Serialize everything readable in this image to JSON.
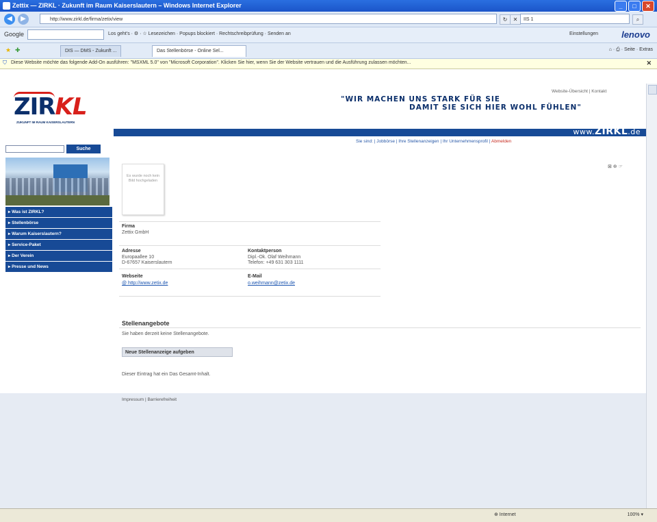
{
  "window": {
    "title": "Zettix — ZIRKL · Zukunft im Raum Kaiserslautern – Windows Internet Explorer",
    "minimize": "_",
    "maximize": "□",
    "close": "✕"
  },
  "addressbar": {
    "url": "http://www.zirkl.de/firma/zetix/view",
    "search_placeholder": "IIS 1",
    "back": "◀",
    "forward": "▶",
    "go": "↻",
    "stop": "✕",
    "search_go": "⌕"
  },
  "googlebar": {
    "label": "Google",
    "items": "Los geht's · ⚙ · ☆ Lesezeichen · Popups blockiert · Rechtschreibprüfung · Senden an",
    "settings": "Einstellungen",
    "brand": "lenovo"
  },
  "tabs": {
    "items": [
      "DIS — DMS - Zukunft ...",
      "Das Stellenbörse - Online Sel..."
    ],
    "tools": "⌂ · ⎙ · Seite · Extras"
  },
  "infobar": {
    "message": "Diese Website möchte das folgende Add-On ausführen: \"MSXML 5.0\" von \"Microsoft Corporation\". Klicken Sie hier, wenn Sie der Website vertrauen und die Ausführung zulassen möchten...",
    "close": "✕"
  },
  "site": {
    "logo_main": "ZIR",
    "logo_accent": "KL",
    "logo_sub": "ZUKUNFT IM RAUM KAISERSLAUTERN",
    "top_links": "Website-Übersicht | Kontakt",
    "slogan_line1": "\"WIR MACHEN UNS STARK FÜR SIE",
    "slogan_line2": "DAMIT SIE SICH HIER WOHL FÜHLEN\"",
    "domain_pre": "www.",
    "domain_brand": "ZIRKL",
    "domain_tld": ".de",
    "subnav": "Sie sind: | Jobbörse | Ihre Stellenanzeigen | Ihr Unternehmensprofil | ",
    "subnav_red": "Abmelden",
    "share": "⊠ ⊕ ☞"
  },
  "sidebar": {
    "search_button": "Suche",
    "menu": [
      "▸ Was ist ZIRKL?",
      "▸ Stellenbörse",
      "▸ Warum Kaiserslautern?",
      "▸ Service-Paket",
      "▸ Der Verein",
      "▸ Presse und News"
    ]
  },
  "company": {
    "thumb_text": "Es wurde noch kein Bild hochgeladen",
    "firma_label": "Firma",
    "firma_value": "Zettix GmbH",
    "adresse_label": "Adresse",
    "adresse_line1": "Europaallee 10",
    "adresse_line2": "D-67657 Kaiserslautern",
    "kontakt_label": "Kontaktperson",
    "kontakt_line1": "Dipl.-Ok. Olaf Weihmann",
    "kontakt_line2": "Telefon: +49 631 303 1111",
    "website_label": "Webseite",
    "website_value": "@ http://www.zetix.de",
    "email_label": "E-Mail",
    "email_value": "o.weihmann@zetix.de"
  },
  "jobs": {
    "title": "Stellenangebote",
    "empty_text": "Sie haben derzeit keine Stellenangebote.",
    "add_button": "Neue Stellenanzeige aufgeben",
    "note": "Dieser Eintrag hat ein Das Gesamt-Inhalt."
  },
  "footer": {
    "links": "Impressum | Barrierefreiheit"
  },
  "statusbar": {
    "left": "",
    "zone": "⊕ Internet",
    "zoom": "100% ▾"
  }
}
